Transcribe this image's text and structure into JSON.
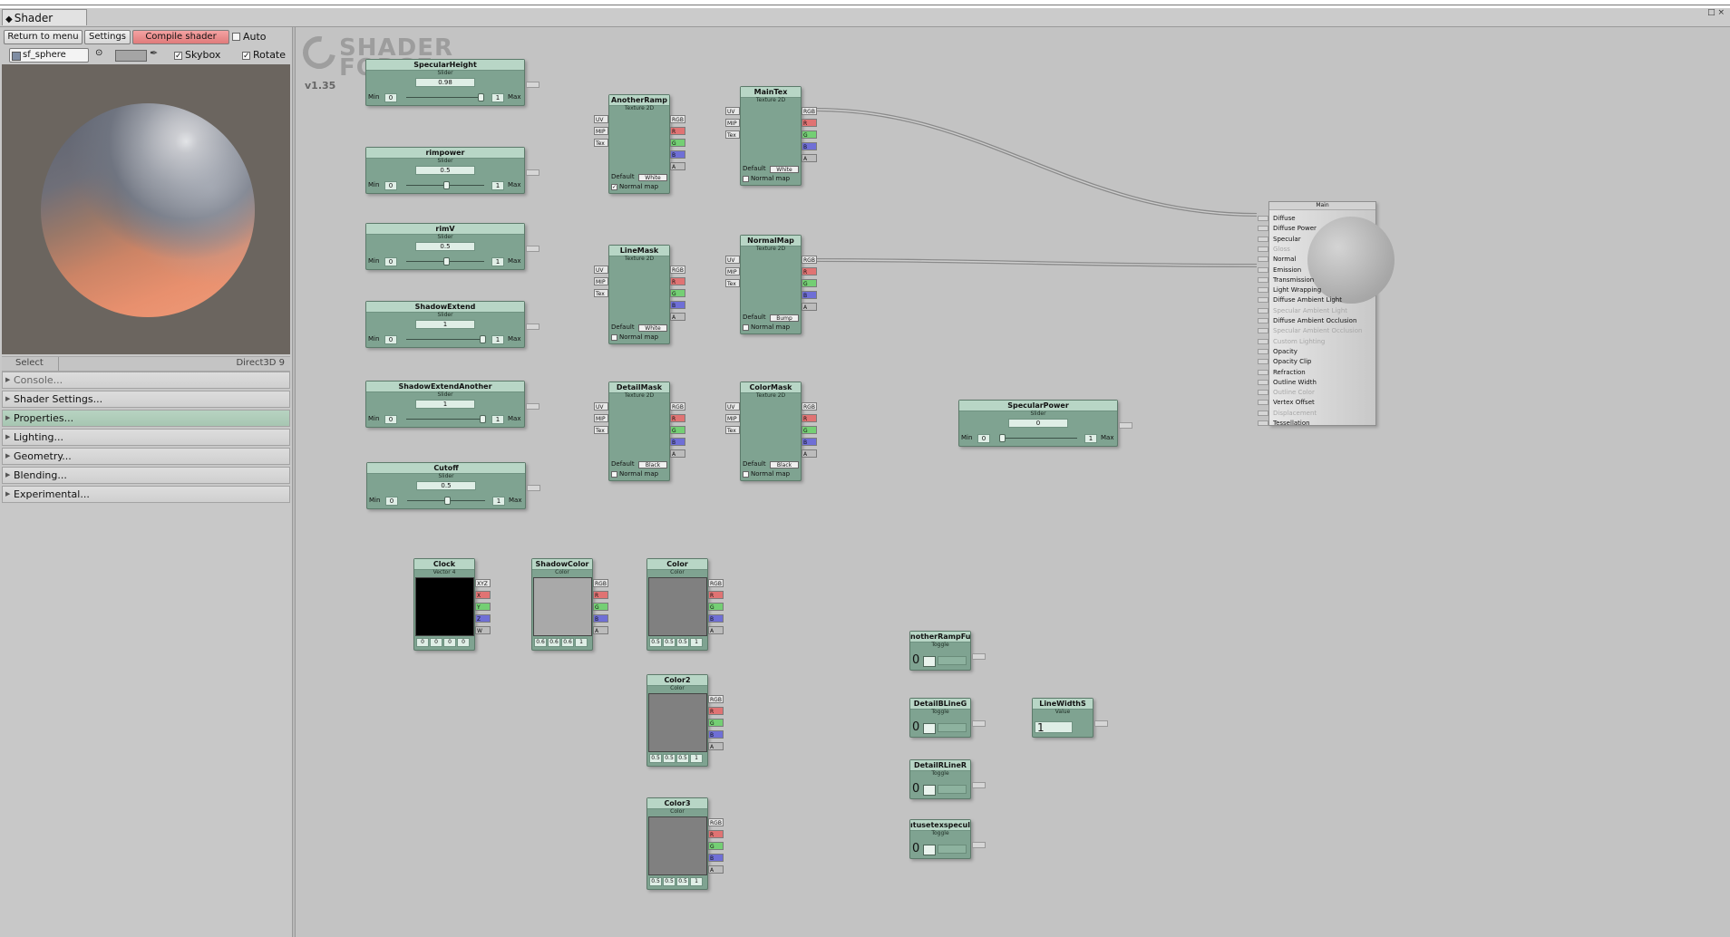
{
  "window": {
    "tab_title": "Shader Forge",
    "controls": "□ ×"
  },
  "toolbar": {
    "return_label": "Return to menu",
    "settings_label": "Settings",
    "compile_label": "Compile shader",
    "auto_label": "Auto",
    "mesh_name": "sf_sphere",
    "skybox_label": "Skybox",
    "rotate_label": "Rotate"
  },
  "status": {
    "select": "Select",
    "renderer": "Direct3D 9"
  },
  "sections": [
    {
      "label": "Console..."
    },
    {
      "label": "Shader Settings..."
    },
    {
      "label": "Properties..."
    },
    {
      "label": "Lighting..."
    },
    {
      "label": "Geometry..."
    },
    {
      "label": "Blending..."
    },
    {
      "label": "Experimental..."
    }
  ],
  "logo": {
    "line1": "SHADER",
    "line2": "FORGE",
    "version": "v1.35"
  },
  "common": {
    "min": "Min",
    "max": "Max",
    "slider_type": "Slider",
    "tex_type": "Texture 2D",
    "color_type": "Color",
    "toggle_type": "Toggle",
    "value_type": "Value",
    "vector_type": "Vector 4",
    "default_label": "Default",
    "normal_map": "Normal map",
    "port_uv": "UV",
    "port_mip": "MIP",
    "port_tex": "Tex",
    "port_rgb": "RGB",
    "port_r": "R",
    "port_g": "G",
    "port_b": "B",
    "port_a": "A",
    "port_xyz": "XYZ",
    "port_x": "X",
    "port_y": "Y",
    "port_z": "Z",
    "port_w": "W"
  },
  "sliders": [
    {
      "title": "SpecularHeight",
      "value": "0.98",
      "min": "0",
      "max": "1",
      "pos": 0.98
    },
    {
      "title": "rimpower",
      "value": "0.5",
      "min": "0",
      "max": "1",
      "pos": 0.5
    },
    {
      "title": "rimV",
      "value": "0.5",
      "min": "0",
      "max": "1",
      "pos": 0.5
    },
    {
      "title": "ShadowExtend",
      "value": "1",
      "min": "0",
      "max": "1",
      "pos": 1.0
    },
    {
      "title": "ShadowExtendAnother",
      "value": "1",
      "min": "0",
      "max": "1",
      "pos": 1.0
    },
    {
      "title": "Cutoff",
      "value": "0.5",
      "min": "0",
      "max": "1",
      "pos": 0.5
    },
    {
      "title": "SpecularPower",
      "value": "0",
      "min": "0",
      "max": "1",
      "pos": 0.0
    }
  ],
  "textures": [
    {
      "title": "AnotherRamp",
      "default": "White",
      "normal_map": true
    },
    {
      "title": "MainTex",
      "default": "White",
      "normal_map": false
    },
    {
      "title": "LineMask",
      "default": "White",
      "normal_map": false
    },
    {
      "title": "NormalMap",
      "default": "Bump",
      "normal_map": false
    },
    {
      "title": "DetailMask",
      "default": "Black",
      "normal_map": false
    },
    {
      "title": "ColorMask",
      "default": "Black",
      "normal_map": false
    }
  ],
  "colors": [
    {
      "title": "Clock",
      "type": "Vector 4",
      "swatch": "#000000",
      "values": [
        "0",
        "0",
        "0",
        "0"
      ]
    },
    {
      "title": "ShadowColor",
      "type": "Color",
      "swatch": "#a9a9a9",
      "values": [
        "0.6",
        "0.6",
        "0.6",
        "1"
      ]
    },
    {
      "title": "Color",
      "type": "Color",
      "swatch": "#808080",
      "values": [
        "0.5",
        "0.5",
        "0.5",
        "1"
      ]
    },
    {
      "title": "Color2",
      "type": "Color",
      "swatch": "#808080",
      "values": [
        "0.5",
        "0.5",
        "0.5",
        "1"
      ]
    },
    {
      "title": "Color3",
      "type": "Color",
      "swatch": "#808080",
      "values": [
        "0.5",
        "0.5",
        "0.5",
        "1"
      ]
    }
  ],
  "toggles": [
    {
      "title": "notherRampFu",
      "value": "0"
    },
    {
      "title": "DetailBLineG",
      "value": "0"
    },
    {
      "title": "DetailRLineR",
      "value": "0"
    },
    {
      "title": "ıtusetexspecul",
      "value": "0"
    }
  ],
  "value_node": {
    "title": "LineWidthS",
    "value": "1"
  },
  "main_node": {
    "title": "Main",
    "inputs": [
      {
        "label": "Diffuse",
        "enabled": true
      },
      {
        "label": "Diffuse Power",
        "enabled": true
      },
      {
        "label": "Specular",
        "enabled": true
      },
      {
        "label": "Gloss",
        "enabled": false
      },
      {
        "label": "Normal",
        "enabled": true
      },
      {
        "label": "Emission",
        "enabled": true
      },
      {
        "label": "Transmission",
        "enabled": true
      },
      {
        "label": "Light Wrapping",
        "enabled": true
      },
      {
        "label": "Diffuse Ambient Light",
        "enabled": true
      },
      {
        "label": "Specular Ambient Light",
        "enabled": false
      },
      {
        "label": "Diffuse Ambient Occlusion",
        "enabled": true
      },
      {
        "label": "Specular Ambient Occlusion",
        "enabled": false
      },
      {
        "label": "Custom Lighting",
        "enabled": false
      },
      {
        "label": "Opacity",
        "enabled": true
      },
      {
        "label": "Opacity Clip",
        "enabled": true
      },
      {
        "label": "Refraction",
        "enabled": true
      },
      {
        "label": "Outline Width",
        "enabled": true
      },
      {
        "label": "Outline Color",
        "enabled": false
      },
      {
        "label": "Vertex Offset",
        "enabled": true
      },
      {
        "label": "Displacement",
        "enabled": false
      },
      {
        "label": "Tessellation",
        "enabled": true
      }
    ]
  }
}
